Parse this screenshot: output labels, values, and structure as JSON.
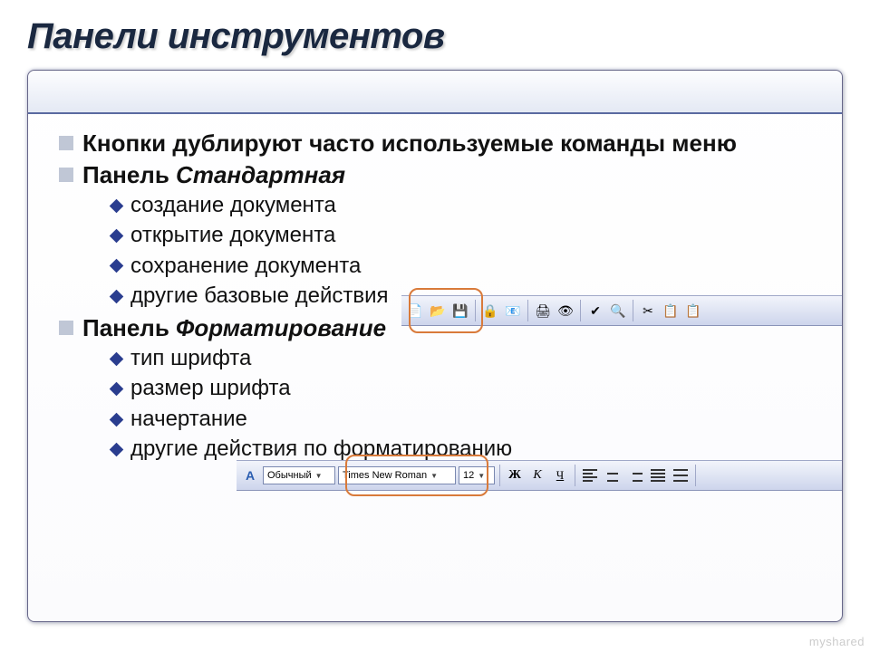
{
  "title": "Панели инструментов",
  "bullets": [
    {
      "text": "Кнопки дублируют часто используемые команды меню"
    },
    {
      "plain": "Панель ",
      "italic": "Стандартная"
    },
    {
      "plain": "Панель ",
      "italic": "Форматирование"
    }
  ],
  "standard_subs": [
    "создание документа",
    "открытие документа",
    "сохранение документа",
    "другие базовые действия"
  ],
  "format_subs": [
    "тип шрифта",
    "размер шрифта",
    "начертание",
    "другие действия по форматированию"
  ],
  "toolbar1_icons": [
    "📄",
    "📂",
    "💾",
    "|",
    "🔒",
    "📧",
    "|",
    "🖨",
    "👁",
    "|",
    "✔",
    "🔍",
    "|",
    "✂",
    "📋",
    "📋"
  ],
  "toolbar2": {
    "style_label": "Обычный",
    "font_label": "Times New Roman",
    "size_label": "12",
    "bold": "Ж",
    "italic": "К",
    "underline": "Ч"
  },
  "watermark": "myshared"
}
